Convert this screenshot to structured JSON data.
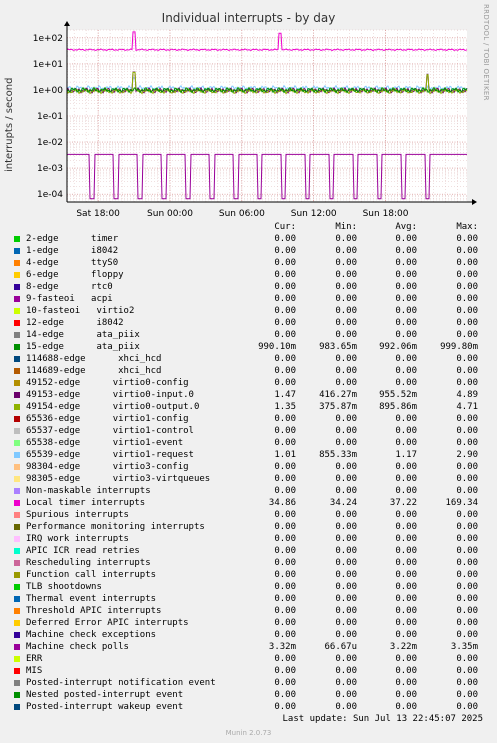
{
  "page": {
    "title": "Individual interrupts - by day",
    "vendor": "RRDTOOL / TOBI OETIKER",
    "last_update": "Last update: Sun Jul 13 22:45:07 2025",
    "munin": "Munin 2.0.73"
  },
  "legend_headers": {
    "cur": "Cur:",
    "min": "Min:",
    "avg": "Avg:",
    "max": "Max:"
  },
  "legend": [
    {
      "label": "2-edge      timer",
      "color": "#00cc00",
      "cur": "0.00",
      "min": "0.00",
      "avg": "0.00",
      "max": "0.00"
    },
    {
      "label": "1-edge      i8042",
      "color": "#0066b3",
      "cur": "0.00",
      "min": "0.00",
      "avg": "0.00",
      "max": "0.00"
    },
    {
      "label": "4-edge      ttyS0",
      "color": "#ff8000",
      "cur": "0.00",
      "min": "0.00",
      "avg": "0.00",
      "max": "0.00"
    },
    {
      "label": "6-edge      floppy",
      "color": "#ffcc00",
      "cur": "0.00",
      "min": "0.00",
      "avg": "0.00",
      "max": "0.00"
    },
    {
      "label": "8-edge      rtc0",
      "color": "#330099",
      "cur": "0.00",
      "min": "0.00",
      "avg": "0.00",
      "max": "0.00"
    },
    {
      "label": "9-fasteoi   acpi",
      "color": "#990099",
      "cur": "0.00",
      "min": "0.00",
      "avg": "0.00",
      "max": "0.00"
    },
    {
      "label": "10-fasteoi   virtio2",
      "color": "#ccff00",
      "cur": "0.00",
      "min": "0.00",
      "avg": "0.00",
      "max": "0.00"
    },
    {
      "label": "12-edge      i8042",
      "color": "#ff0000",
      "cur": "0.00",
      "min": "0.00",
      "avg": "0.00",
      "max": "0.00"
    },
    {
      "label": "14-edge      ata_piix",
      "color": "#808080",
      "cur": "0.00",
      "min": "0.00",
      "avg": "0.00",
      "max": "0.00"
    },
    {
      "label": "15-edge      ata_piix",
      "color": "#008f00",
      "cur": "990.10m",
      "min": "983.65m",
      "avg": "992.06m",
      "max": "999.80m"
    },
    {
      "label": "114688-edge      xhci_hcd",
      "color": "#00487d",
      "cur": "0.00",
      "min": "0.00",
      "avg": "0.00",
      "max": "0.00"
    },
    {
      "label": "114689-edge      xhci_hcd",
      "color": "#b35a00",
      "cur": "0.00",
      "min": "0.00",
      "avg": "0.00",
      "max": "0.00"
    },
    {
      "label": "49152-edge      virtio0-config",
      "color": "#b38f00",
      "cur": "0.00",
      "min": "0.00",
      "avg": "0.00",
      "max": "0.00"
    },
    {
      "label": "49153-edge      virtio0-input.0",
      "color": "#6b006b",
      "cur": "1.47",
      "min": "416.27m",
      "avg": "955.52m",
      "max": "4.89"
    },
    {
      "label": "49154-edge      virtio0-output.0",
      "color": "#8fb300",
      "cur": "1.35",
      "min": "375.87m",
      "avg": "895.86m",
      "max": "4.71"
    },
    {
      "label": "65536-edge      virtio1-config",
      "color": "#b30000",
      "cur": "0.00",
      "min": "0.00",
      "avg": "0.00",
      "max": "0.00"
    },
    {
      "label": "65537-edge      virtio1-control",
      "color": "#bebebe",
      "cur": "0.00",
      "min": "0.00",
      "avg": "0.00",
      "max": "0.00"
    },
    {
      "label": "65538-edge      virtio1-event",
      "color": "#80ff80",
      "cur": "0.00",
      "min": "0.00",
      "avg": "0.00",
      "max": "0.00"
    },
    {
      "label": "65539-edge      virtio1-request",
      "color": "#80c9ff",
      "cur": "1.01",
      "min": "855.33m",
      "avg": "1.17",
      "max": "2.90"
    },
    {
      "label": "98304-edge      virtio3-config",
      "color": "#ffc080",
      "cur": "0.00",
      "min": "0.00",
      "avg": "0.00",
      "max": "0.00"
    },
    {
      "label": "98305-edge      virtio3-virtqueues",
      "color": "#ffe680",
      "cur": "0.00",
      "min": "0.00",
      "avg": "0.00",
      "max": "0.00"
    },
    {
      "label": "Non-maskable interrupts",
      "color": "#aa80ff",
      "cur": "0.00",
      "min": "0.00",
      "avg": "0.00",
      "max": "0.00"
    },
    {
      "label": "Local timer interrupts",
      "color": "#ee00cc",
      "cur": "34.86",
      "min": "34.24",
      "avg": "37.22",
      "max": "169.34"
    },
    {
      "label": "Spurious interrupts",
      "color": "#ff8080",
      "cur": "0.00",
      "min": "0.00",
      "avg": "0.00",
      "max": "0.00"
    },
    {
      "label": "Performance monitoring interrupts",
      "color": "#666600",
      "cur": "0.00",
      "min": "0.00",
      "avg": "0.00",
      "max": "0.00"
    },
    {
      "label": "IRQ work interrupts",
      "color": "#ffbfff",
      "cur": "0.00",
      "min": "0.00",
      "avg": "0.00",
      "max": "0.00"
    },
    {
      "label": "APIC ICR read retries",
      "color": "#00ffcc",
      "cur": "0.00",
      "min": "0.00",
      "avg": "0.00",
      "max": "0.00"
    },
    {
      "label": "Rescheduling interrupts",
      "color": "#cc6699",
      "cur": "0.00",
      "min": "0.00",
      "avg": "0.00",
      "max": "0.00"
    },
    {
      "label": "Function call interrupts",
      "color": "#999900",
      "cur": "0.00",
      "min": "0.00",
      "avg": "0.00",
      "max": "0.00"
    },
    {
      "label": "TLB shootdowns",
      "color": "#00cc00",
      "cur": "0.00",
      "min": "0.00",
      "avg": "0.00",
      "max": "0.00"
    },
    {
      "label": "Thermal event interrupts",
      "color": "#0066b3",
      "cur": "0.00",
      "min": "0.00",
      "avg": "0.00",
      "max": "0.00"
    },
    {
      "label": "Threshold APIC interrupts",
      "color": "#ff8000",
      "cur": "0.00",
      "min": "0.00",
      "avg": "0.00",
      "max": "0.00"
    },
    {
      "label": "Deferred Error APIC interrupts",
      "color": "#ffcc00",
      "cur": "0.00",
      "min": "0.00",
      "avg": "0.00",
      "max": "0.00"
    },
    {
      "label": "Machine check exceptions",
      "color": "#330099",
      "cur": "0.00",
      "min": "0.00",
      "avg": "0.00",
      "max": "0.00"
    },
    {
      "label": "Machine check polls",
      "color": "#990099",
      "cur": "3.32m",
      "min": "66.67u",
      "avg": "3.22m",
      "max": "3.35m"
    },
    {
      "label": "ERR",
      "color": "#ccff00",
      "cur": "0.00",
      "min": "0.00",
      "avg": "0.00",
      "max": "0.00"
    },
    {
      "label": "MIS",
      "color": "#ff0000",
      "cur": "0.00",
      "min": "0.00",
      "avg": "0.00",
      "max": "0.00"
    },
    {
      "label": "Posted-interrupt notification event",
      "color": "#808080",
      "cur": "0.00",
      "min": "0.00",
      "avg": "0.00",
      "max": "0.00"
    },
    {
      "label": "Nested posted-interrupt event",
      "color": "#008f00",
      "cur": "0.00",
      "min": "0.00",
      "avg": "0.00",
      "max": "0.00"
    },
    {
      "label": "Posted-interrupt wakeup event",
      "color": "#00487d",
      "cur": "0.00",
      "min": "0.00",
      "avg": "0.00",
      "max": "0.00"
    }
  ],
  "chart_data": {
    "type": "line",
    "title": "Individual interrupts - by day",
    "ylabel": "interrupts / second",
    "yscale": "log",
    "ylim": [
      5e-05,
      200
    ],
    "y_ticks": [
      "1e+02",
      "1e+01",
      "1e+00",
      "1e-01",
      "1e-02",
      "1e-03",
      "1e-04"
    ],
    "y_tick_values": [
      100,
      10,
      1,
      0.1,
      0.01,
      0.001,
      0.0001
    ],
    "x_ticks": [
      "Sat 18:00",
      "Sun 00:00",
      "Sun 06:00",
      "Sun 12:00",
      "Sun 18:00"
    ],
    "x_tick_hours": [
      0,
      6,
      12,
      18,
      24
    ],
    "x_range_hours": [
      -2.6,
      30.8
    ],
    "grid": true,
    "series": [
      {
        "name": "Local timer interrupts",
        "color": "#ee00cc",
        "base": 35,
        "spikes": [
          [
            3.0,
            169.34
          ],
          [
            15.2,
            150
          ]
        ],
        "dips": []
      },
      {
        "name": "65539-edge      virtio1-request",
        "color": "#80c9ff",
        "base": 1.17,
        "spikes": [
          [
            3.0,
            2.9
          ]
        ],
        "dips": []
      },
      {
        "name": "49153-edge      virtio0-input.0",
        "color": "#6b006b",
        "base": 0.96,
        "spikes": [
          [
            3.0,
            4.89
          ],
          [
            27.5,
            4.0
          ]
        ],
        "dips": []
      },
      {
        "name": "49154-edge      virtio0-output.0",
        "color": "#8fb300",
        "base": 0.9,
        "spikes": [
          [
            3.0,
            4.71
          ],
          [
            27.5,
            3.8
          ]
        ],
        "dips": []
      },
      {
        "name": "15-edge      ata_piix",
        "color": "#008f00",
        "base": 0.992,
        "spikes": [],
        "dips": []
      },
      {
        "name": "Machine check polls",
        "color": "#990099",
        "base": 0.00335,
        "spikes": [],
        "dips_value": 6.67e-05,
        "dips": [
          -0.5,
          1.5,
          3.5,
          5.5,
          7.5,
          9.5,
          11.5,
          13.5,
          15.5,
          17.5,
          19.5,
          21.5,
          23.5,
          25.5,
          27.5
        ]
      }
    ]
  }
}
